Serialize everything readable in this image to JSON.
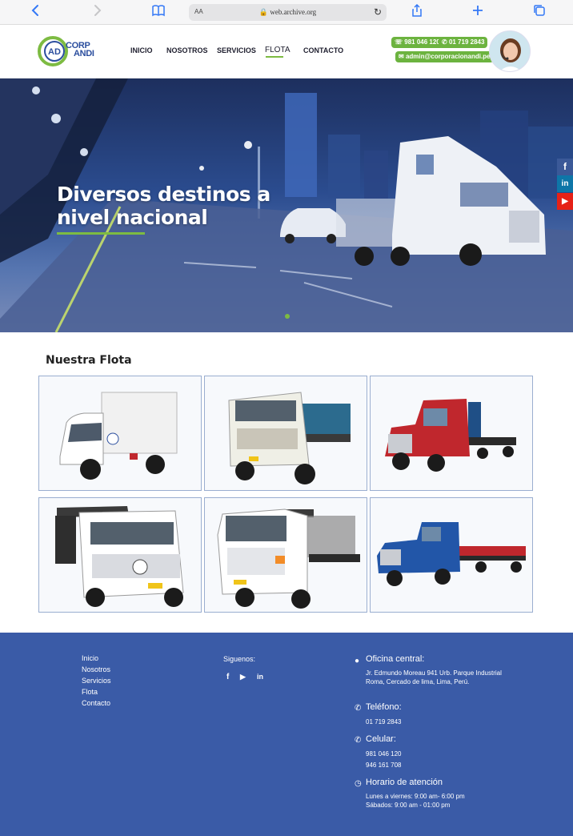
{
  "browser": {
    "text_size_label": "AA",
    "url": "web.archive.org"
  },
  "header": {
    "logo_line1": "CORP",
    "logo_line2": "ANDI",
    "logo_mark": "AD",
    "nav": [
      "INICIO",
      "NOSOTROS",
      "SERVICIOS",
      "FLOTA",
      "CONTACTO"
    ],
    "active_nav": "FLOTA",
    "phone_whatsapp": "981 046 120",
    "phone_landline": "01 719 2843",
    "email": "admin@corporacionandi.pe"
  },
  "hero": {
    "title_line1": "Diversos destinos a",
    "title_line2": "nivel nacional",
    "slide_count": 1,
    "social": [
      "f",
      "in",
      "▶"
    ]
  },
  "fleet": {
    "title": "Nuestra Flota",
    "tiles": [
      {
        "icon": "box-truck-image",
        "cab": "#ffffff",
        "body": "#f3f3f3"
      },
      {
        "icon": "flatbed-truck-image",
        "cab": "#efefe6",
        "body": "#2c6b8e"
      },
      {
        "icon": "red-semi-truck-image",
        "cab": "#c0272d",
        "body": "#1f4f86"
      },
      {
        "icon": "crane-truck-image",
        "cab": "#ffffff",
        "body": "#3a3a3a"
      },
      {
        "icon": "hino-crane-truck-image",
        "cab": "#ffffff",
        "body": "#8a8a8a"
      },
      {
        "icon": "blue-semi-truck-image",
        "cab": "#2256a8",
        "body": "#c0272d"
      }
    ]
  },
  "footer": {
    "links": [
      "Inicio",
      "Nosotros",
      "Servicios",
      "Flota",
      "Contacto"
    ],
    "follow_label": "Siguenos:",
    "follow_icons": [
      "f",
      "▶",
      "in"
    ],
    "office_title": "Oficina central:",
    "office_text": "Jr. Edmundo Moreau 941 Urb. Parque Industrial Roma, Cercado de lima, Lima, Perú.",
    "phone_title": "Teléfono:",
    "phone_text": "01 719 2843",
    "mobile_title": "Celular:",
    "mobile_1": "981 046 120",
    "mobile_2": "946 161 708",
    "hours_title": "Horario de atención",
    "hours_1": "Lunes a viernes: 9:00 am- 6:00 pm",
    "hours_2": "Sábados: 9:00 am - 01:00 pm"
  },
  "colors": {
    "brand_green": "#7dbb42",
    "brand_blue": "#2b4e9e",
    "footer_blue": "#3a5ba7"
  }
}
